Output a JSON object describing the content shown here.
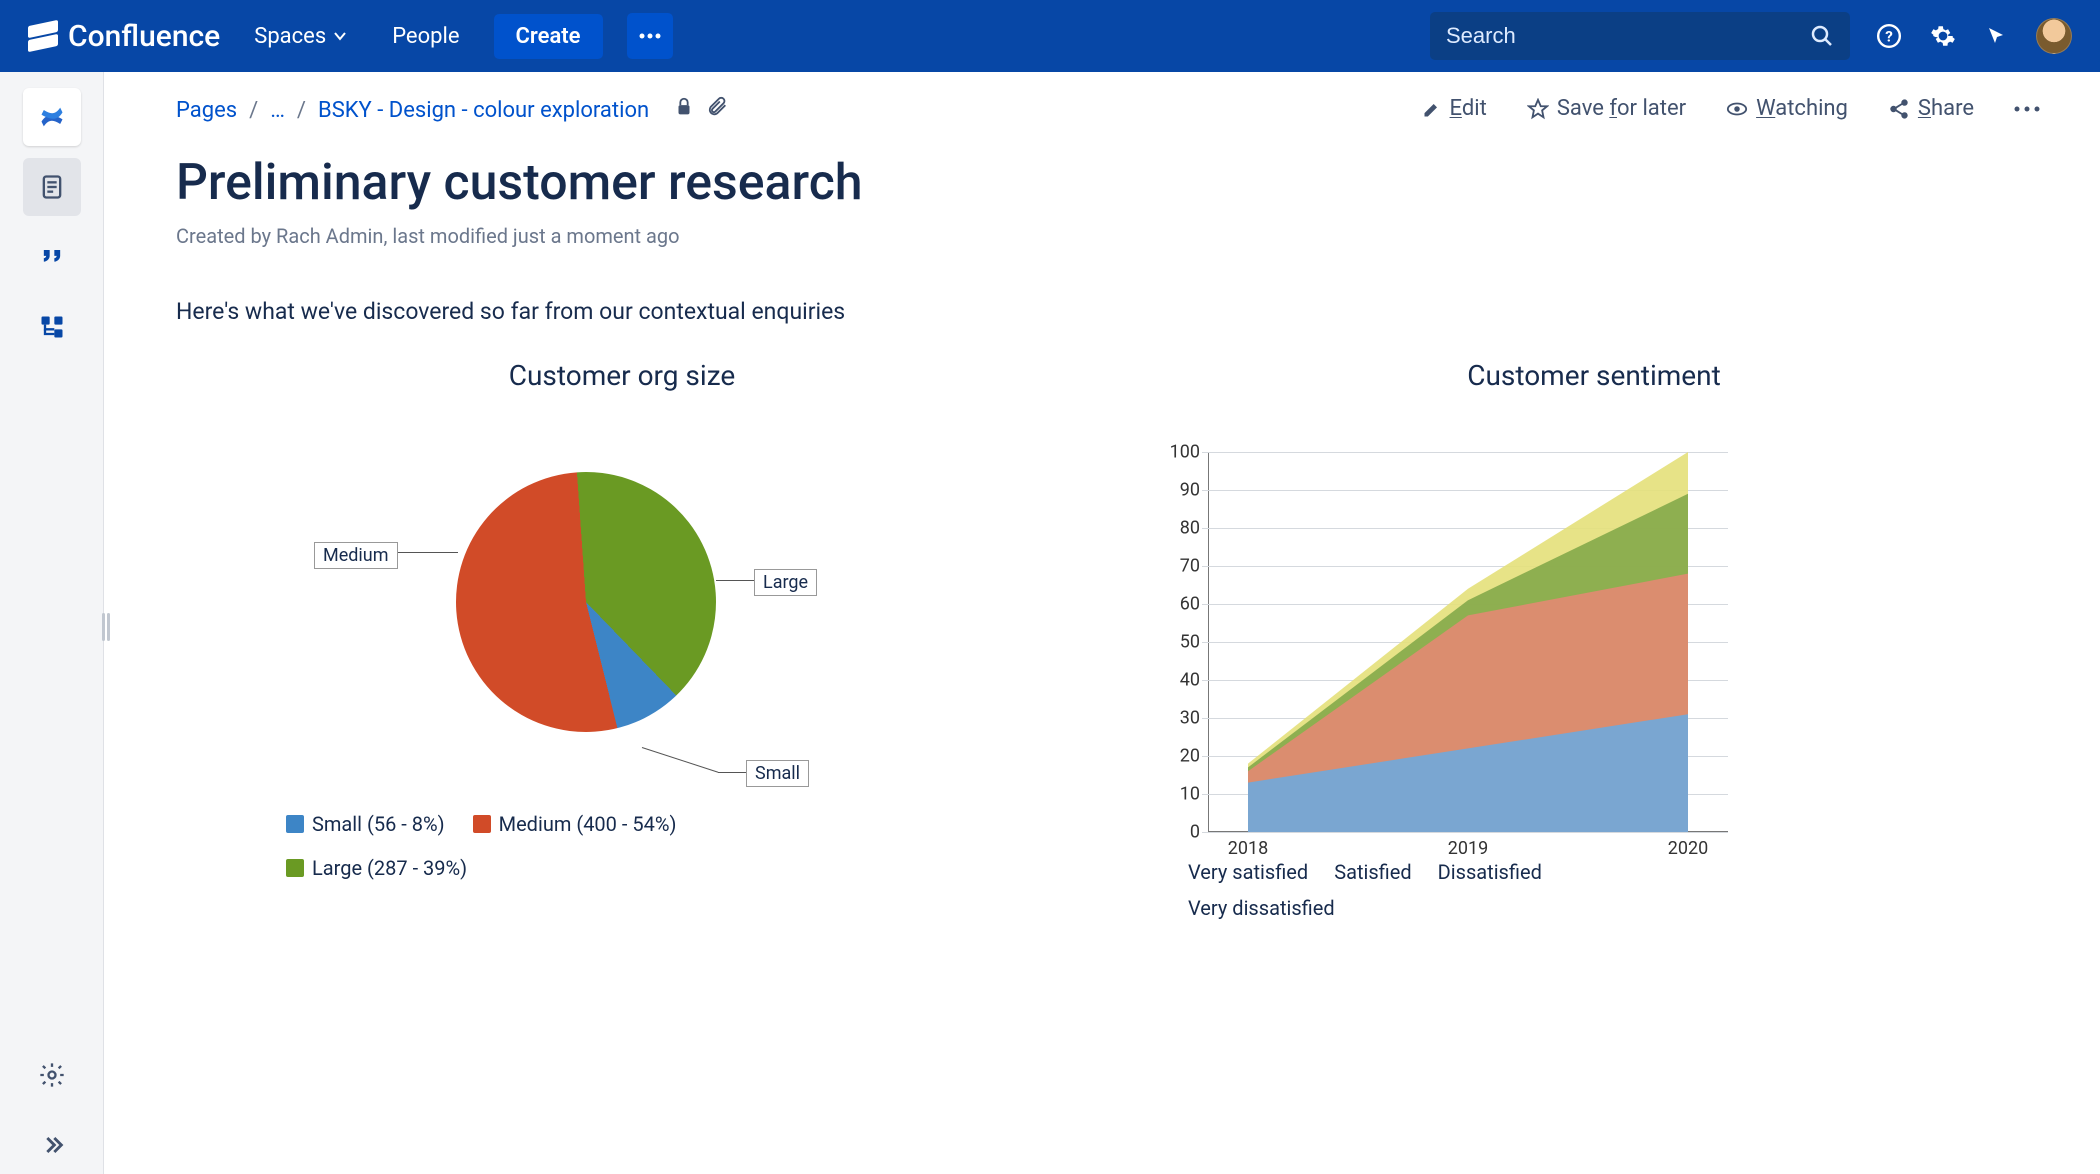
{
  "brand": "Confluence",
  "nav": {
    "spaces": "Spaces",
    "people": "People",
    "create": "Create",
    "search_placeholder": "Search"
  },
  "breadcrumb": {
    "pages": "Pages",
    "sep": "/",
    "ellipsis": "…",
    "current": "BSKY - Design - colour exploration"
  },
  "page_actions": {
    "edit": "Edit",
    "save": "Save for later",
    "watching": "Watching",
    "share": "Share"
  },
  "page": {
    "title": "Preliminary customer research",
    "byline": "Created by Rach Admin, last modified just a moment ago",
    "intro": "Here's what we've discovered so far from our contextual enquiries"
  },
  "colors": {
    "small": "#3D85C6",
    "medium": "#D14B28",
    "large": "#6A9A23",
    "very_satisfied": "#6FA8DC",
    "satisfied": "#E38A72",
    "dissatisfied": "#84A84A",
    "very_dissatisfied": "#E4E07A"
  },
  "chart_data": [
    {
      "type": "pie",
      "title": "Customer org size",
      "slices": [
        {
          "name": "Small",
          "value": 56,
          "percent": 8
        },
        {
          "name": "Medium",
          "value": 400,
          "percent": 54
        },
        {
          "name": "Large",
          "value": 287,
          "percent": 39
        }
      ],
      "legend": [
        "Small (56 - 8%)",
        "Medium (400 - 54%)",
        "Large (287 - 39%)"
      ],
      "slice_labels": {
        "small": "Small",
        "medium": "Medium",
        "large": "Large"
      }
    },
    {
      "type": "area",
      "title": "Customer sentiment",
      "x": [
        "2018",
        "2019",
        "2020"
      ],
      "ylim": [
        0,
        100
      ],
      "yticks": [
        0,
        10,
        20,
        30,
        40,
        50,
        60,
        70,
        80,
        90,
        100
      ],
      "series": [
        {
          "name": "Very satisfied",
          "values": [
            13,
            22,
            31
          ]
        },
        {
          "name": "Satisfied",
          "values": [
            3,
            35,
            37
          ]
        },
        {
          "name": "Dissatisfied",
          "values": [
            1,
            4,
            21
          ]
        },
        {
          "name": "Very dissatisfied",
          "values": [
            1,
            3,
            11
          ]
        }
      ],
      "legend": [
        "Very satisfied",
        "Satisfied",
        "Dissatisfied",
        "Very dissatisfied"
      ]
    }
  ]
}
